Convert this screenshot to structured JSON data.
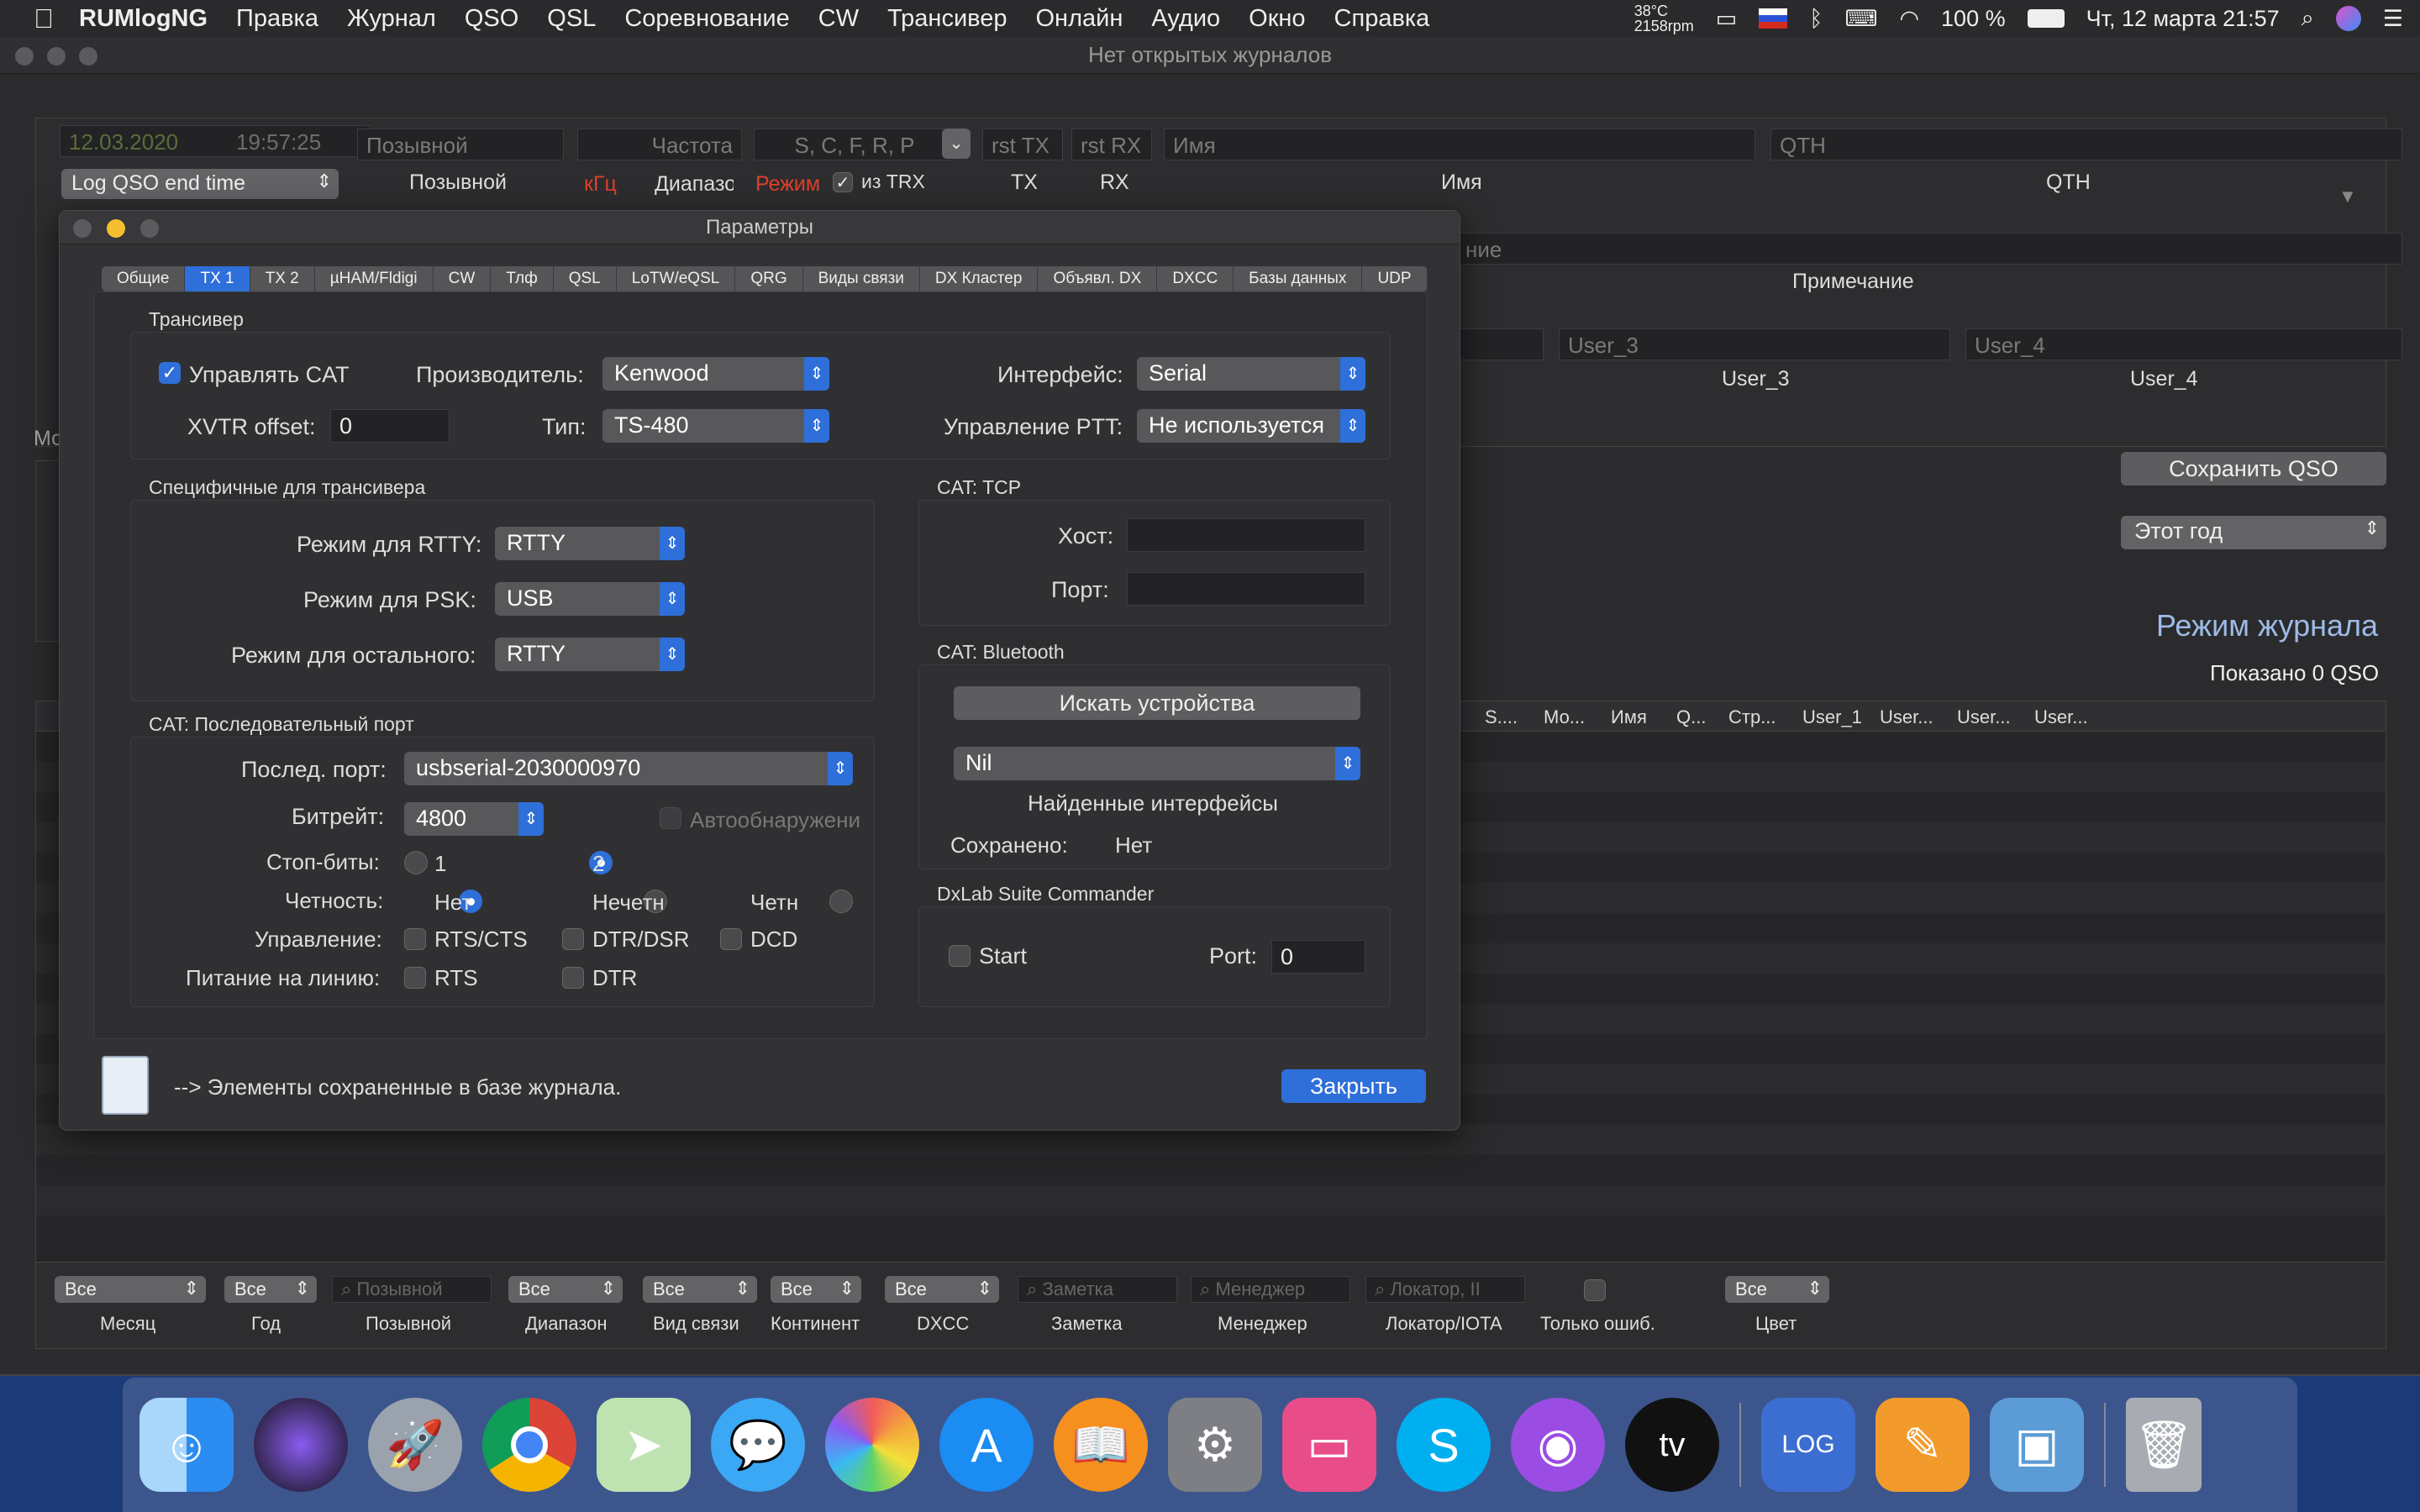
{
  "menubar": {
    "app": "RUMlogNG",
    "items": [
      "Правка",
      "Журнал",
      "QSO",
      "QSL",
      "Соревнование",
      "CW",
      "Трансивер",
      "Онлайн",
      "Аудио",
      "Окно",
      "Справка"
    ],
    "temp": "38°C",
    "rpm": "2158rpm",
    "battery": "100 %",
    "datetime": "Чт, 12 марта  21:57"
  },
  "window": {
    "title": "Нет открытых журналов"
  },
  "entry": {
    "date": "12.03.2020",
    "time": "19:57:25",
    "callsign_ph": "Позывной",
    "freq_ph": "Частота",
    "mode_ph": "S, C, F, R, P",
    "rsttx_ph": "rst TX",
    "rstrx_ph": "rst RX",
    "name_ph": "Имя",
    "qth_ph": "QTH",
    "log_option": "Log QSO end time",
    "lbl_callsign": "Позывной",
    "lbl_khz": "кГц",
    "lbl_band": "Диапазо",
    "lbl_mode": "Режим",
    "lbl_from_trx": "из TRX",
    "lbl_tx": "TX",
    "lbl_rx": "RX",
    "lbl_name": "Имя",
    "lbl_qth": "QTH",
    "note_ph": "ние",
    "lbl_note": "Примечание",
    "user3_ph": "User_3",
    "user4_ph": "User_4",
    "lbl_user3": "User_3",
    "lbl_user4": "User_4"
  },
  "side": {
    "save_qso": "Сохранить QSO",
    "period": "Этот год",
    "log_mode": "Режим журнала",
    "shown": "Показано 0 QSO",
    "mo": "Мс",
    "col_headers": [
      "S....",
      "Мо...",
      "Имя",
      "Q...",
      "Стр...",
      "User_1",
      "User...",
      "User...",
      "User..."
    ]
  },
  "dialog": {
    "title": "Параметры",
    "tabs": [
      "Общие",
      "TX 1",
      "TX 2",
      "µHAM/Fldigi",
      "CW",
      "Тлф",
      "QSL",
      "LoTW/eQSL",
      "QRG",
      "Виды связи",
      "DX Кластер",
      "Объявл. DX",
      "DXCC",
      "Базы данных",
      "UDP"
    ],
    "active_tab": "TX 1",
    "trx_group": "Трансивер",
    "cat_control": "Управлять CAT",
    "manufacturer_lbl": "Производитель:",
    "manufacturer": "Kenwood",
    "interface_lbl": "Интерфейс:",
    "interface": "Serial",
    "xvtr_lbl": "XVTR offset:",
    "xvtr": "0",
    "type_lbl": "Тип:",
    "type": "TS-480",
    "ptt_lbl": "Управление PTT:",
    "ptt": "Не используется",
    "specific_group": "Специфичные для трансивера",
    "rtty_lbl": "Режим для RTTY:",
    "rtty": "RTTY",
    "psk_lbl": "Режим для PSK:",
    "psk": "USB",
    "other_lbl": "Режим для остального:",
    "other": "RTTY",
    "tcp_group": "CAT: TCP",
    "host_lbl": "Хост:",
    "port_lbl": "Порт:",
    "bt_group": "CAT: Bluetooth",
    "search_btn": "Искать устройства",
    "bt_device": "Nil",
    "found_lbl": "Найденные интерфейсы",
    "saved_lbl": "Сохранено:",
    "saved_val": "Нет",
    "serial_group": "CAT: Последовательный порт",
    "port_lbl2": "Послед. порт:",
    "serial_port": "usbserial-2030000970",
    "baud_lbl": "Битрейт:",
    "baud": "4800",
    "autodetect": "Автообнаружени",
    "stop_lbl": "Стоп-биты:",
    "stop1": "1",
    "stop2": "2",
    "parity_lbl": "Четность:",
    "parity_none": "Нет",
    "parity_odd": "Нечетн",
    "parity_even": "Четн",
    "ctrl_lbl": "Управление:",
    "rtscts": "RTS/CTS",
    "dtrdsr": "DTR/DSR",
    "dcd": "DCD",
    "power_lbl": "Питание на линию:",
    "rts": "RTS",
    "dtr": "DTR",
    "dxlab_group": "DxLab Suite Commander",
    "start": "Start",
    "dxport_lbl": "Port:",
    "dxport": "0",
    "footer_note": "--> Элементы сохраненные в базе журнала.",
    "close_btn": "Закрыть"
  },
  "filters": [
    {
      "value": "Все",
      "label": "Месяц"
    },
    {
      "value": "Все",
      "label": "Год"
    },
    {
      "value": "Позывной",
      "label": "Позывной"
    },
    {
      "value": "Все",
      "label": "Диапазон"
    },
    {
      "value": "Все",
      "label": "Вид связи"
    },
    {
      "value": "Все",
      "label": "Континент"
    },
    {
      "value": "Все",
      "label": "DXCC"
    },
    {
      "value": "Заметка",
      "label": "Заметка"
    },
    {
      "value": "Менеджер",
      "label": "Менеджер"
    },
    {
      "value": "Локатор, II",
      "label": "Локатор/IOTA"
    },
    {
      "value": "",
      "label": "Только ошиб."
    },
    {
      "value": "Все",
      "label": "Цвет"
    }
  ],
  "dock": [
    "finder-icon",
    "siri-icon",
    "launchpad-icon",
    "chrome-icon",
    "maps-icon",
    "messages-icon",
    "photos-icon",
    "app-store-icon",
    "books-icon",
    "system-preferences-icon",
    "cleanmymac-icon",
    "skype-icon",
    "podcasts-icon",
    "apple-tv-icon",
    "rumlog-icon",
    "pages-icon",
    "preview-icon",
    "trash-icon"
  ]
}
